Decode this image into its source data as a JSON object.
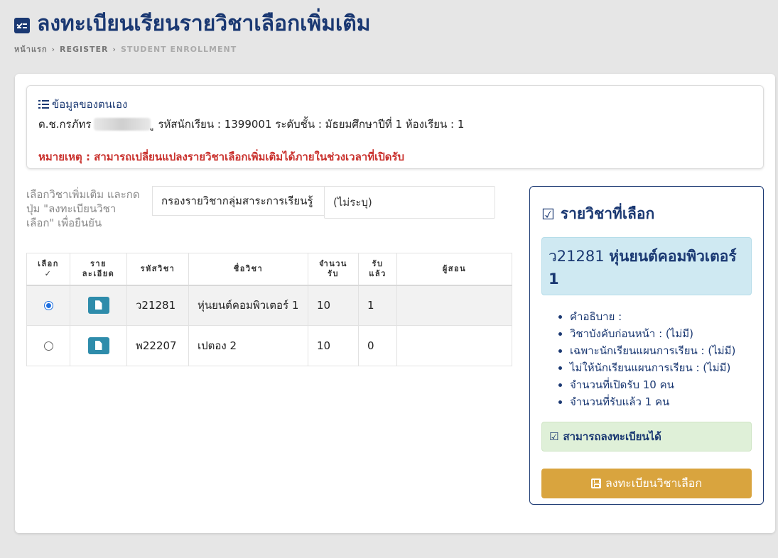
{
  "header": {
    "title": "ลงทะเบียนเรียนรายวิชาเลือกเพิ่มเติม",
    "icon": "checklist-icon",
    "breadcrumb": [
      "หน้าแรก",
      "REGISTER",
      "STUDENT ENROLLMENT"
    ]
  },
  "profile": {
    "heading": "ข้อมูลของตนเอง",
    "name_prefix": "ด.ช.กรภัทร",
    "name_suffix": "ู",
    "details": "รหัสนักเรียน : 1399001 ระดับชั้น : มัธยมศึกษาปีที่ 1 ห้องเรียน : 1",
    "note": "หมายเหตุ : สามารถเปลี่ยนแปลงรายวิชาเลือกเพิ่มเติมได้ภายในช่วงเวลาที่เปิดรับ"
  },
  "selector": {
    "instructions": "เลือกวิชาเพิ่มเติม และกดปุ่ม \"ลงทะเบียนวิชาเลือก\" เพื่อยืนยัน",
    "filter_label": "กรองรายวิชากลุ่มสาระการเรียนรู้",
    "filter_value": "(ไม่ระบุ)"
  },
  "table": {
    "headers": {
      "select": "เลือก",
      "select_mark": "✓",
      "detail_1": "ราย",
      "detail_2": "ละเอียด",
      "code": "รหัสวิชา",
      "name": "ชื่อวิชา",
      "capacity_1": "จำนวน",
      "capacity_2": "รับ",
      "accepted_1": "รับ",
      "accepted_2": "แล้ว",
      "teacher": "ผู้สอน"
    },
    "rows": [
      {
        "selected": true,
        "code": "ว21281",
        "name": "หุ่นยนต์คอมพิวเตอร์ 1",
        "capacity": "10",
        "accepted": "1",
        "teacher": ""
      },
      {
        "selected": false,
        "code": "พ22207",
        "name": "เปตอง 2",
        "capacity": "10",
        "accepted": "0",
        "teacher": ""
      }
    ]
  },
  "selected_panel": {
    "title": "รายวิชาที่เลือก",
    "course_code": "ว21281",
    "course_name": "หุ่นยนต์คอมพิวเตอร์ 1",
    "details": [
      "คำอธิบาย :",
      "วิชาบังคับก่อนหน้า : (ไม่มี)",
      "เฉพาะนักเรียนแผนการเรียน : (ไม่มี)",
      "ไม่ให้นักเรียนแผนการเรียน : (ไม่มี)",
      "จำนวนที่เปิดรับ 10 คน",
      "จำนวนที่รับแล้ว 1 คน"
    ],
    "status": "สามารถลงทะเบียนได้",
    "status_mark": "☑",
    "title_mark": "☑",
    "button_label": "ลงทะเบียนวิชาเลือก"
  },
  "colors": {
    "primary": "#1a3872",
    "danger": "#c9302c",
    "info_bg": "#cfe9f2",
    "success_bg": "#dff0d8",
    "button": "#d9a43e",
    "detail_button": "#2e8cab"
  }
}
